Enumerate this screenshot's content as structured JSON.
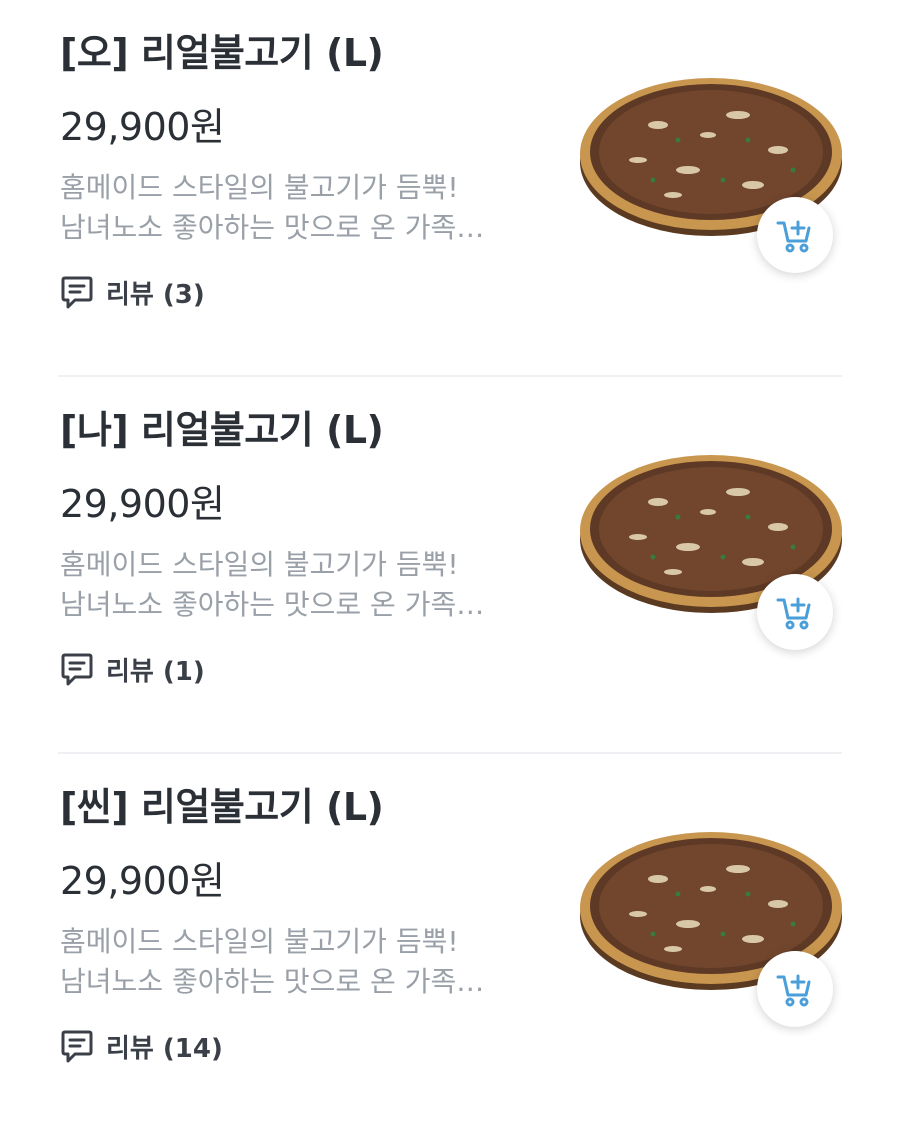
{
  "menu_items": [
    {
      "title": "[오] 리얼불고기 (L)",
      "price": "29,900원",
      "desc_line1": "홈메이드 스타일의  불고기가 듬뿍!",
      "desc_line2": "남녀노소 좋아하는 맛으로 온 가족…",
      "review_label": "리뷰 (3)"
    },
    {
      "title": "[나] 리얼불고기 (L)",
      "price": "29,900원",
      "desc_line1": "홈메이드 스타일의  불고기가 듬뿍!",
      "desc_line2": "남녀노소 좋아하는 맛으로 온 가족…",
      "review_label": "리뷰 (1)"
    },
    {
      "title": "[씬] 리얼불고기 (L)",
      "price": "29,900원",
      "desc_line1": "홈메이드 스타일의  불고기가 듬뿍!",
      "desc_line2": "남녀노소 좋아하는 맛으로 온 가족…",
      "review_label": "리뷰 (14)"
    }
  ],
  "icons": {
    "review": "comment-icon",
    "cart": "add-to-cart-icon",
    "product": "pizza-image"
  },
  "colors": {
    "accent": "#4a9fd8",
    "text_primary": "#2b2f36",
    "text_secondary": "#9aa0a8"
  }
}
